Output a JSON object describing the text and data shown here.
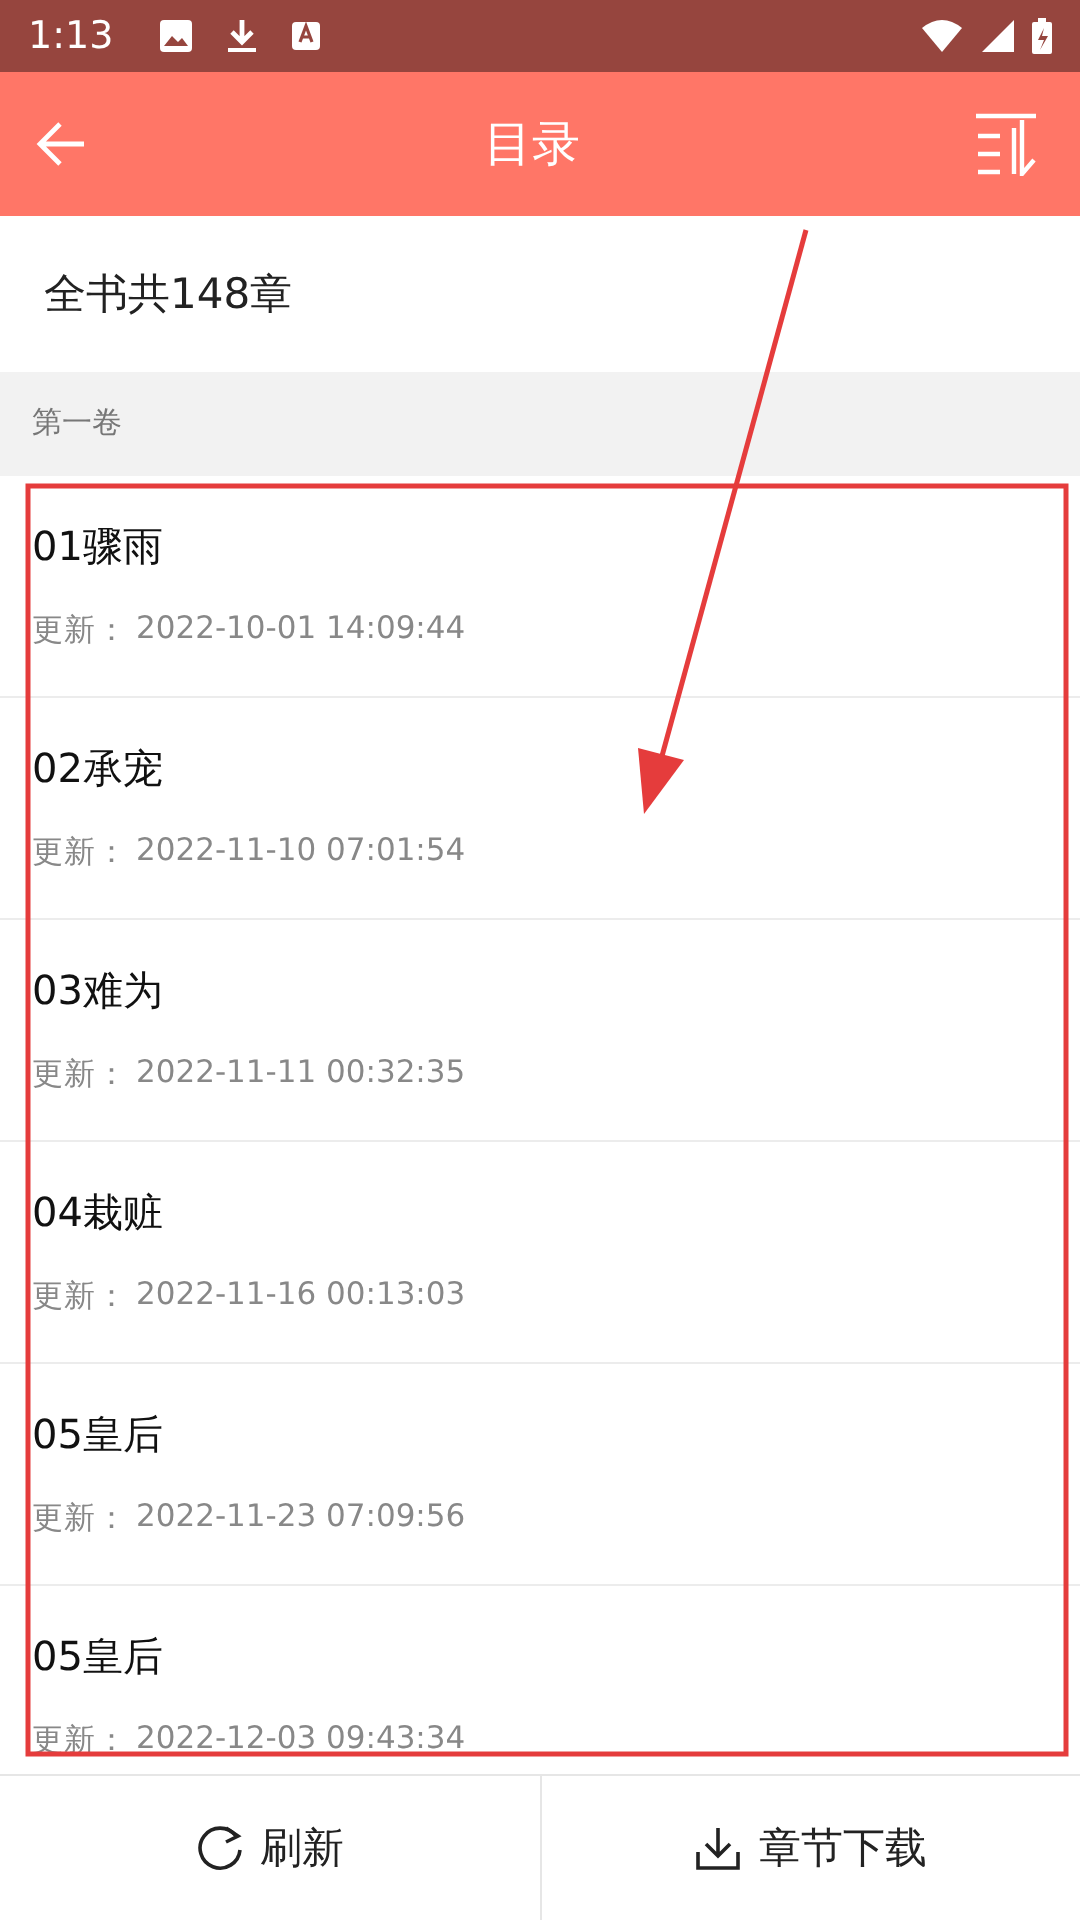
{
  "status_bar": {
    "time": "1:13"
  },
  "header": {
    "title": "目录"
  },
  "summary": "全书共148章",
  "volume": "第一卷",
  "chapters": [
    {
      "title": "01骤雨",
      "updated_label": "更新：",
      "updated": "2022-10-01 14:09:44"
    },
    {
      "title": "02承宠",
      "updated_label": "更新：",
      "updated": "2022-11-10 07:01:54"
    },
    {
      "title": "03难为",
      "updated_label": "更新：",
      "updated": "2022-11-11 00:32:35"
    },
    {
      "title": "04栽赃",
      "updated_label": "更新：",
      "updated": "2022-11-16 00:13:03"
    },
    {
      "title": "05皇后",
      "updated_label": "更新：",
      "updated": "2022-11-23 07:09:56"
    },
    {
      "title": "05皇后",
      "updated_label": "更新：",
      "updated": "2022-12-03 09:43:34"
    }
  ],
  "bottom_bar": [
    {
      "kind": "refresh",
      "label": "刷新"
    },
    {
      "kind": "download",
      "label": "章节下载"
    }
  ]
}
